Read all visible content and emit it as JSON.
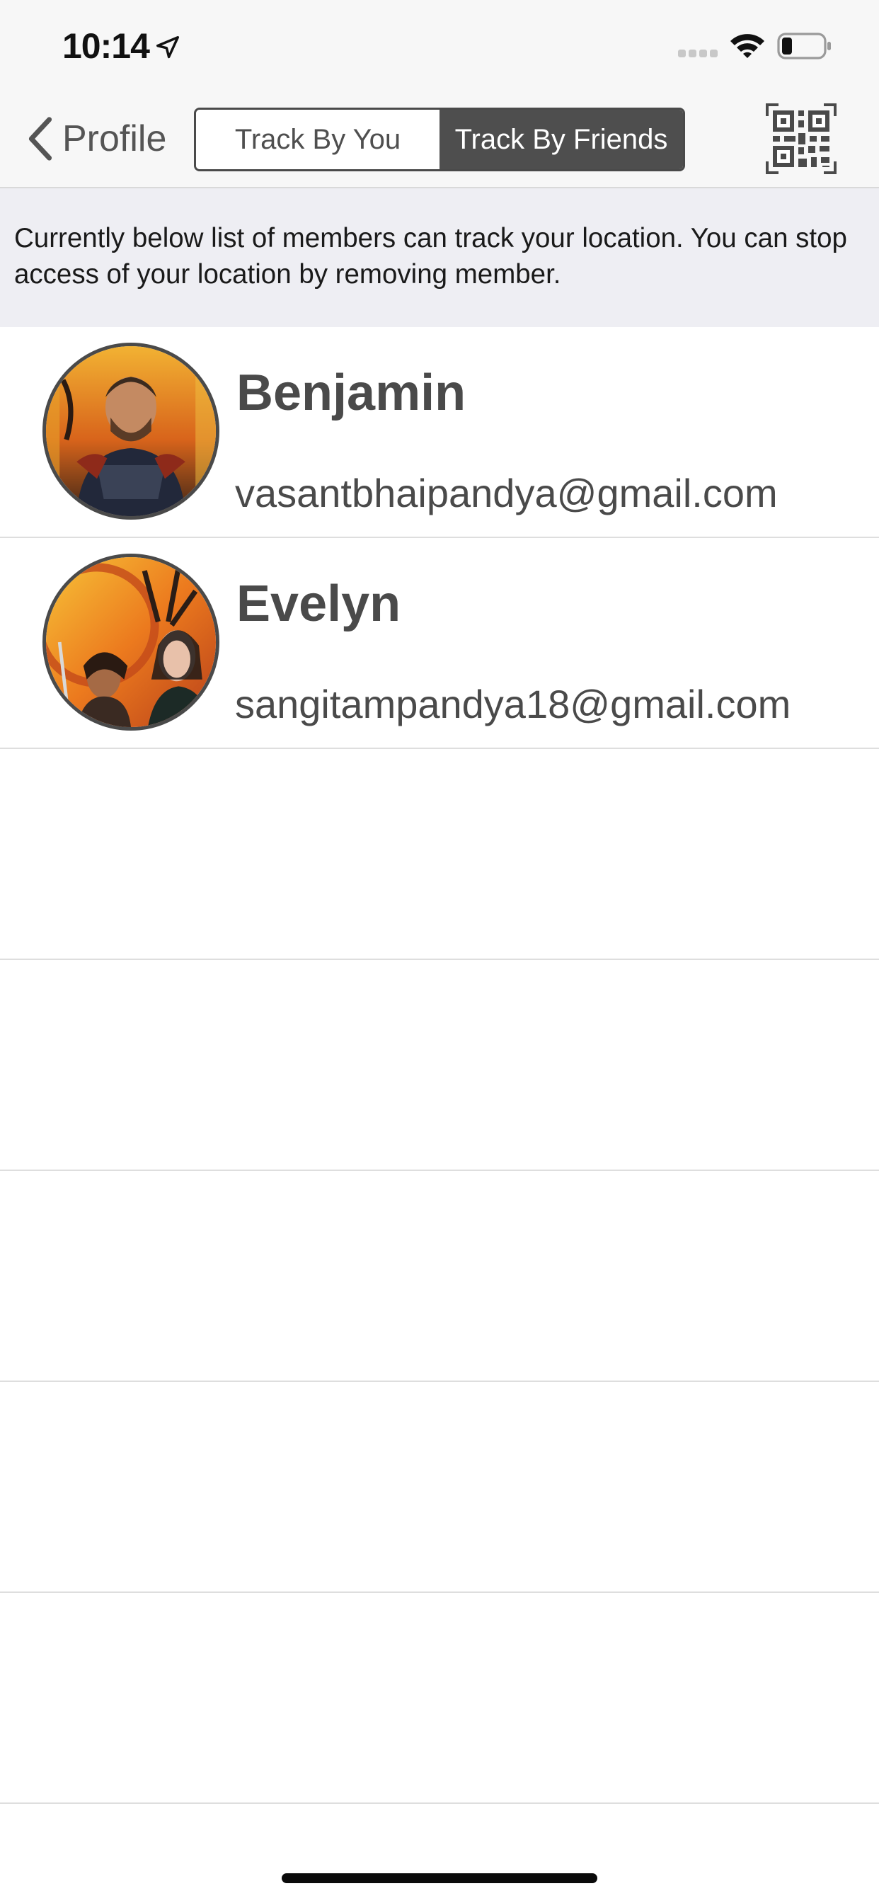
{
  "status_bar": {
    "time": "10:14",
    "icons": [
      "location-arrow-icon",
      "cellular-signal-icon",
      "wifi-icon",
      "battery-icon"
    ]
  },
  "nav": {
    "back_label": "Profile",
    "segments": [
      {
        "label": "Track By You",
        "selected": false
      },
      {
        "label": "Track By Friends",
        "selected": true
      }
    ],
    "qr_icon": "qr-code-icon"
  },
  "info_text": "Currently below list of members can track your location. You can stop access of your location by removing member.",
  "members": [
    {
      "name": "Benjamin",
      "email": "vasantbhaipandya@gmail.com"
    },
    {
      "name": "Evelyn",
      "email": "sangitampandya18@gmail.com"
    }
  ],
  "colors": {
    "accent": "#4e4e4e",
    "banner_bg": "#eeeef3",
    "bar_bg": "#f7f7f7",
    "separator": "#dedede"
  }
}
